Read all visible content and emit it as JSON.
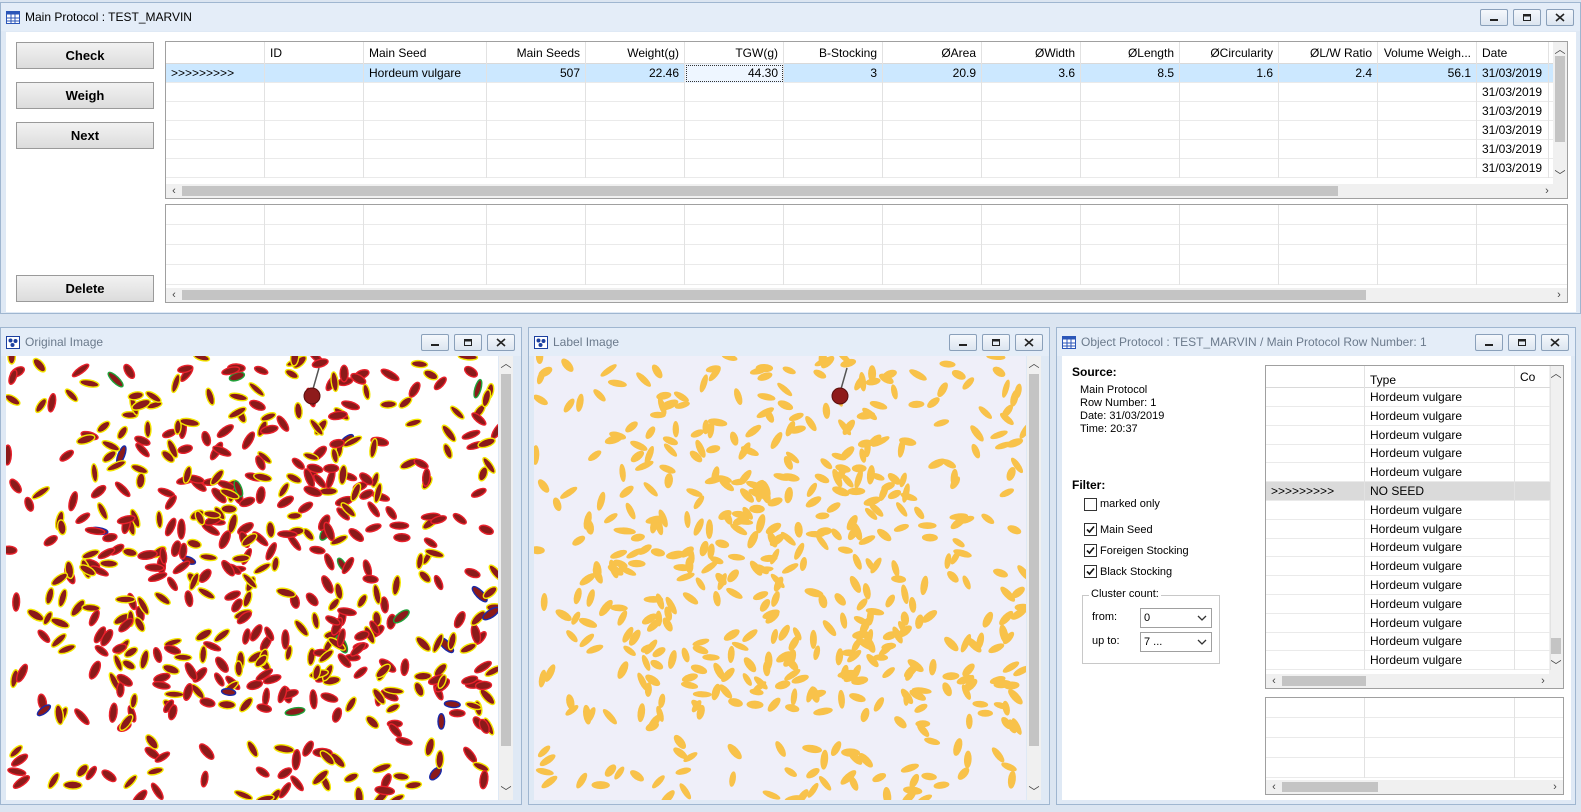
{
  "main_window": {
    "title": "Main Protocol : TEST_MARVIN",
    "buttons": {
      "check": "Check",
      "weigh": "Weigh",
      "next": "Next",
      "delete": "Delete"
    },
    "grid": {
      "columns": [
        "",
        "ID",
        "Main Seed",
        "Main Seeds",
        "Weight(g)",
        "TGW(g)",
        "B-Stocking",
        "ØArea",
        "ØWidth",
        "ØLength",
        "ØCircularity",
        "ØL/W Ratio",
        "Volume Weigh...",
        "Date"
      ],
      "rows": [
        [
          ">>>>>>>>>",
          "",
          "Hordeum vulgare",
          "507",
          "22.46",
          "44.30",
          "3",
          "20.9",
          "3.6",
          "8.5",
          "1.6",
          "2.4",
          "56.1",
          "31/03/2019"
        ],
        [
          "",
          "",
          "",
          "",
          "",
          "",
          "",
          "",
          "",
          "",
          "",
          "",
          "",
          "31/03/2019"
        ],
        [
          "",
          "",
          "",
          "",
          "",
          "",
          "",
          "",
          "",
          "",
          "",
          "",
          "",
          "31/03/2019"
        ],
        [
          "",
          "",
          "",
          "",
          "",
          "",
          "",
          "",
          "",
          "",
          "",
          "",
          "",
          "31/03/2019"
        ],
        [
          "",
          "",
          "",
          "",
          "",
          "",
          "",
          "",
          "",
          "",
          "",
          "",
          "",
          "31/03/2019"
        ],
        [
          "",
          "",
          "",
          "",
          "",
          "",
          "",
          "",
          "",
          "",
          "",
          "",
          "",
          "31/03/2019"
        ]
      ]
    }
  },
  "original_window": {
    "title": "Original Image"
  },
  "label_window": {
    "title": "Label Image"
  },
  "object_window": {
    "title": "Object Protocol : TEST_MARVIN / Main Protocol Row Number: 1",
    "source": {
      "heading": "Source:",
      "protocol": "Main Protocol",
      "row": "Row Number: 1",
      "date": "Date: 31/03/2019",
      "time": "Time: 20:37"
    },
    "filter": {
      "heading": "Filter:",
      "marked_only": "marked only",
      "main_seed": "Main Seed",
      "foreign": "Foreigen Stocking",
      "black": "Black Stocking",
      "cluster": "Cluster count:",
      "from_label": "from:",
      "from_value": "0",
      "upto_label": "up to:",
      "upto_value": "7 ..."
    },
    "grid": {
      "columns": [
        "",
        "Type",
        "Co"
      ],
      "rows": [
        [
          "",
          "Hordeum vulgare"
        ],
        [
          "",
          "Hordeum vulgare"
        ],
        [
          "",
          "Hordeum vulgare"
        ],
        [
          "",
          "Hordeum vulgare"
        ],
        [
          "",
          "Hordeum vulgare"
        ],
        [
          ">>>>>>>>>",
          "NO SEED"
        ],
        [
          "",
          "Hordeum vulgare"
        ],
        [
          "",
          "Hordeum vulgare"
        ],
        [
          "",
          "Hordeum vulgare"
        ],
        [
          "",
          "Hordeum vulgare"
        ],
        [
          "",
          "Hordeum vulgare"
        ],
        [
          "",
          "Hordeum vulgare"
        ],
        [
          "",
          "Hordeum vulgare"
        ],
        [
          "",
          "Hordeum vulgare"
        ],
        [
          "",
          "Hordeum vulgare"
        ]
      ]
    }
  },
  "colors": {
    "seed_fill_original": "#8b1a1a",
    "seed_outline_red": "#e8212c",
    "seed_outline_yellow": "#f4e600",
    "seed_outline_green": "#1fa33a",
    "seed_outline_blue": "#1a2aa8",
    "seed_fill_label": "#f8c24a",
    "label_background": "#efeff9",
    "selection": "#cce8ff"
  }
}
